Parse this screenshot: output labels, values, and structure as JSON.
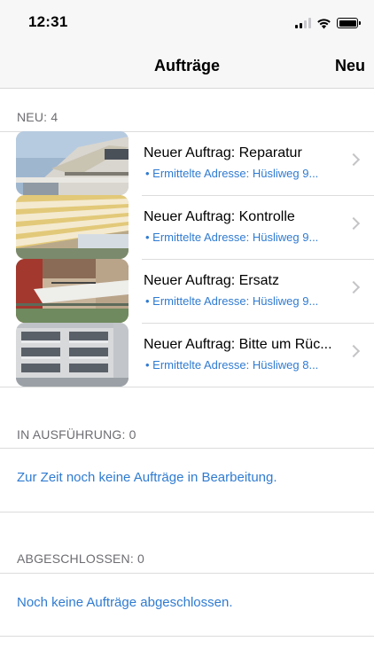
{
  "status_bar": {
    "time": "12:31"
  },
  "nav": {
    "title": "Aufträge",
    "action": "Neu"
  },
  "sections": {
    "new": {
      "header": "NEU: 4",
      "items": [
        {
          "title": "Neuer Auftrag: Reparatur",
          "subtitle": "• Ermittelte Adresse: Hüsliweg 9...",
          "thumbnail": "awning-photo-1"
        },
        {
          "title": "Neuer Auftrag: Kontrolle",
          "subtitle": "• Ermittelte Adresse: Hüsliweg 9...",
          "thumbnail": "awning-photo-2"
        },
        {
          "title": "Neuer Auftrag: Ersatz",
          "subtitle": "• Ermittelte Adresse: Hüsliweg 9...",
          "thumbnail": "awning-photo-3"
        },
        {
          "title": "Neuer Auftrag: Bitte um Rüc...",
          "subtitle": "• Ermittelte Adresse: Hüsliweg 8...",
          "thumbnail": "awning-photo-4"
        }
      ]
    },
    "in_progress": {
      "header": "IN AUSFÜHRUNG: 0",
      "message": "Zur Zeit noch keine Aufträge in Bearbeitung."
    },
    "completed": {
      "header": "ABGESCHLOSSEN: 0",
      "message": "Noch keine Aufträge abgeschlossen."
    }
  },
  "colors": {
    "accent": "#2f7bd1",
    "section_header": "#6d6d72",
    "bar_background": "#f7f7f7",
    "separator": "#dcdcdc"
  }
}
